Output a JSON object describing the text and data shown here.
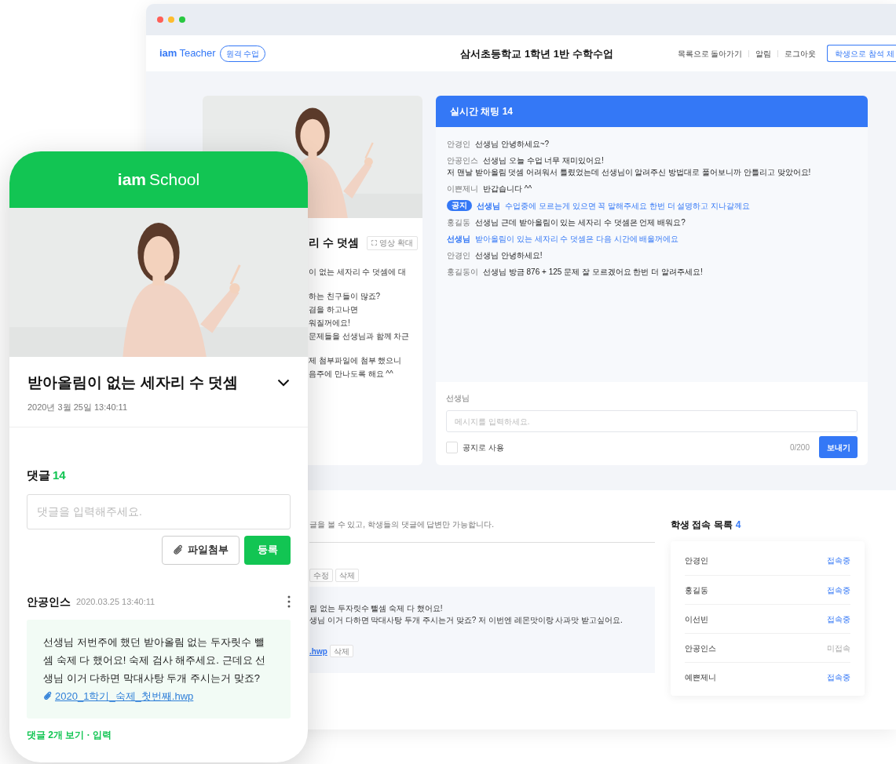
{
  "browser": {
    "header": {
      "logo_bold": "iam",
      "logo_light": "Teacher",
      "mode_badge": "원격 수업",
      "title": "삼서초등학교 1학년 1반 수학수업",
      "nav": [
        {
          "label": "목록으로 돌아가기"
        },
        {
          "label": "알림"
        },
        {
          "label": "로그아웃"
        }
      ],
      "action_button": "학생으로 참석 체"
    },
    "video_card": {
      "kind": "picture",
      "title": "리 수 덧셈",
      "expand_button": "영상 확대",
      "paragraphs": [
        [
          "이 없는 세자리 수 덧셈에 대"
        ],
        [
          "하는 친구들이 많죠?",
          "겸을 하고나면",
          "워질꺼에요!",
          "문제들을 선생님과 함께 차근"
        ],
        [
          "제 첨부파일에 첨부 했으니",
          "음주에 만나도록 해요 ^^"
        ]
      ]
    },
    "chat": {
      "title": "실시간 채팅 14",
      "messages": [
        {
          "kind": "student",
          "name": "안경인",
          "lines": [
            "선생님 안녕하세요~?"
          ]
        },
        {
          "kind": "student",
          "name": "안공인스",
          "lines": [
            "선생님 오늘 수업 너무 재미있어요!",
            "저 맨날 받아올림 덧셈 어려워서 틀렸었는데 선생님이 알려주신 방법대로 풀어보니까 안틀리고 맞았어요!"
          ]
        },
        {
          "kind": "student",
          "name": "이쁜제니",
          "lines": [
            "반갑습니다 ^^"
          ]
        },
        {
          "kind": "notice",
          "badge": "공지",
          "name": "선생님",
          "lines": [
            "수업중에 모르는게 있으면 꼭 말해주세요 한번 더 설명하고 지나갈께요"
          ]
        },
        {
          "kind": "student",
          "name": "홍길동",
          "lines": [
            "선생님 근데 받아올림이 있는 세자리 수 덧셈은 언제 배워요?"
          ]
        },
        {
          "kind": "teacher",
          "name": "선생님",
          "lines": [
            "받아올림이 있는 세자리 수 덧셈은 다음 시간에 배울꺼에요"
          ]
        },
        {
          "kind": "student",
          "name": "안경인",
          "lines": [
            "선생님 안녕하세요!"
          ]
        },
        {
          "kind": "student",
          "name": "홍길동이",
          "lines": [
            "선생님 방금 876 + 125 문제 잘 모르겠어요 한번 더 알려주세요!"
          ]
        }
      ],
      "composer": {
        "label": "선생님",
        "placeholder": "메시지를 입력하세요.",
        "notice_checkbox": {
          "label": "공지로 사용",
          "checked": false
        },
        "counter": "0/200",
        "send_button": "보내기"
      }
    },
    "comments_panel": {
      "notice_text": "글을 볼 수 있고, 학생들의 댓글에 답변만 가능합니다.",
      "buttons": [
        "수정",
        "삭제"
      ],
      "message_lines": [
        "림 없는 두자릿수 뺄셈 숙제 다 했어요!",
        "생님 이거 다하면 막대사탕 두개 주시는거 맞죠? 저 이번엔 레몬맛이랑 사과맛 받고싶어요."
      ],
      "attachment": ".hwp",
      "attachment_delete": "삭제"
    },
    "students": {
      "title": "학생 접속 목록",
      "count": "4",
      "items": [
        {
          "name": "안경인",
          "status": "접속중",
          "online": true
        },
        {
          "name": "홍길동",
          "status": "접속중",
          "online": true
        },
        {
          "name": "이선빈",
          "status": "접속중",
          "online": true
        },
        {
          "name": "안공인스",
          "status": "미접속",
          "online": false
        },
        {
          "name": "예쁜제니",
          "status": "접속중",
          "online": true
        }
      ]
    }
  },
  "phone": {
    "logo_bold": "iam",
    "logo_light": "School",
    "post": {
      "title": "받아올림이 없는 세자리 수 덧셈",
      "date": "2020년 3월 25일 13:40:11"
    },
    "comments": {
      "label": "댓글",
      "count": "14",
      "placeholder": "댓글을 입력해주세요.",
      "attach_button": "파일첨부",
      "submit_button": "등록"
    },
    "comment": {
      "author": "안공인스",
      "time": "2020.03.25 13:40:11",
      "text": "선생님 저번주에 했던 받아올림 없는 두자릿수 뺄셈 숙제 다 했어요! 숙제 검사 해주세요. 근데요 선생님 이거 다하면 막대사탕 두개 주시는거 맞죠?",
      "attachment": "2020_1학기_숙제_첫번째.hwp",
      "replies_link": "댓글 2개 보기 · 입력"
    }
  }
}
